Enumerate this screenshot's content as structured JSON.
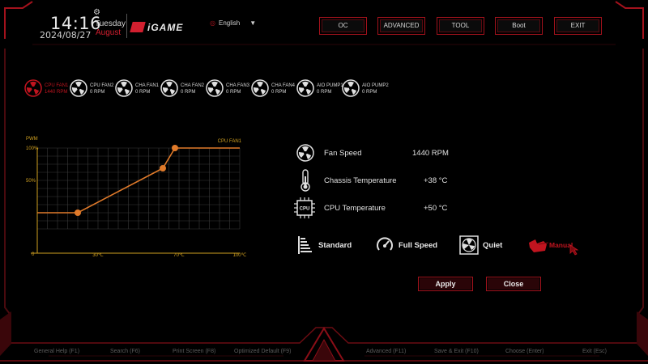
{
  "header": {
    "time": "14:16",
    "date": "2024/08/27",
    "day": "Tuesday",
    "month": "August",
    "logo": "iGAME",
    "language": "English",
    "nav": [
      "OC",
      "ADVANCED",
      "TOOL",
      "Boot",
      "EXIT"
    ]
  },
  "fans": [
    {
      "name": "CPU FAN1",
      "rpm": "1440 RPM",
      "selected": true
    },
    {
      "name": "CPU FAN2",
      "rpm": "0 RPM"
    },
    {
      "name": "CHA FAN1",
      "rpm": "0 RPM"
    },
    {
      "name": "CHA FAN2",
      "rpm": "0 RPM"
    },
    {
      "name": "CHA FAN3",
      "rpm": "0 RPM"
    },
    {
      "name": "CHA FAN4",
      "rpm": "0 RPM"
    },
    {
      "name": "AIO PUMP1",
      "rpm": "0 RPM"
    },
    {
      "name": "AIO PUMP2",
      "rpm": "0 RPM"
    }
  ],
  "chart_data": {
    "type": "line",
    "title": "CPU FAN1",
    "ylabel": "PWM",
    "ytick_labels": [
      "100%",
      "50%",
      "0"
    ],
    "xtick_labels": [
      "30℃",
      "70℃",
      "100℃"
    ],
    "xlim": [
      0,
      100
    ],
    "ylim": [
      0,
      100
    ],
    "grid": true,
    "series": [
      {
        "name": "CPU FAN1",
        "x": [
          0,
          20,
          62,
          68,
          100
        ],
        "y": [
          20,
          20,
          75,
          100,
          100
        ],
        "control_points": [
          1,
          2,
          3
        ]
      }
    ],
    "colors": {
      "line": "#e07a2a",
      "axis": "#d0a020",
      "grid": "#3a3a3a"
    }
  },
  "info": {
    "fan_speed_label": "Fan Speed",
    "fan_speed_value": "1440 RPM",
    "chassis_temp_label": "Chassis Temperature",
    "chassis_temp_value": "+38 °C",
    "cpu_temp_label": "CPU Temperature",
    "cpu_temp_value": "+50 °C",
    "cpu_chip_text": "CPU"
  },
  "modes": {
    "standard": "Standard",
    "full_speed": "Full Speed",
    "quiet": "Quiet",
    "manual": "Manual",
    "selected": "manual"
  },
  "actions": {
    "apply": "Apply",
    "close": "Close"
  },
  "footer": [
    "General Help (F1)",
    "Search (F6)",
    "Print Screen (F8)",
    "Optimized Default (F9)",
    "Advanced (F11)",
    "Save & Exit (F10)",
    "Choose (Enter)",
    "Exit (Esc)"
  ],
  "colors": {
    "accent": "#c0141f",
    "text": "#e0e0e0",
    "frame": "#8a0e17"
  }
}
